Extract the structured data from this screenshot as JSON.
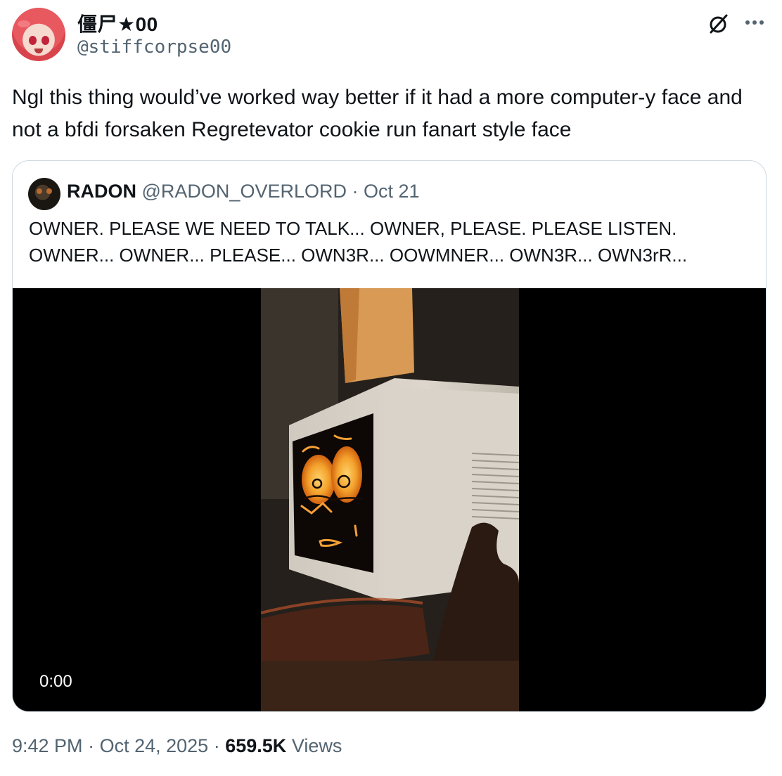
{
  "author": {
    "display_name": "僵尸★00",
    "handle": "@stiffcorpse00"
  },
  "icons": {
    "grok": "grok-icon",
    "more": "more-icon",
    "play_overlay": "none"
  },
  "tweet": {
    "text": "Ngl this thing would’ve worked way better if it had a more computer-y face and not a bfdi forsaken Regretevator cookie run fanart style face"
  },
  "quote": {
    "display_name": "RADON",
    "handle": "@RADON_OVERLORD",
    "separator": "·",
    "date": "Oct 21",
    "text": "OWNER. PLEASE WE NEED TO TALK... OWNER, PLEASE. PLEASE LISTEN. OWNER... OWNER... PLEASE... OWN3R... OOWMNER... OWN3R... OWN3rR...",
    "video": {
      "time": "0:00"
    }
  },
  "footer": {
    "time": "9:42 PM",
    "sep1": "·",
    "date": "Oct 24, 2025",
    "sep2": "·",
    "views_count": "659.5K",
    "views_label": "Views"
  },
  "colors": {
    "text_primary": "#0f1419",
    "text_secondary": "#536471",
    "border": "#cfd9de"
  }
}
